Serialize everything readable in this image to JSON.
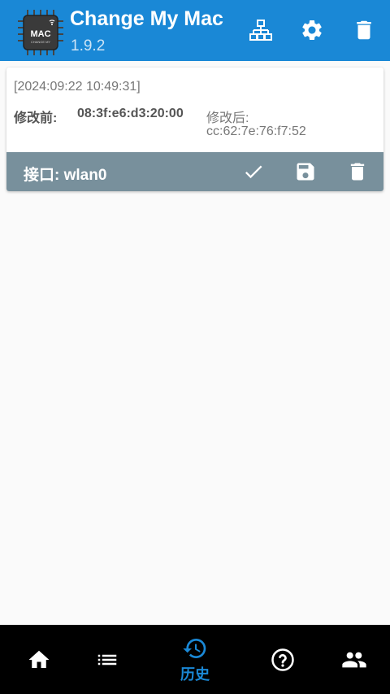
{
  "app": {
    "title": "Change My Mac",
    "version": "1.9.2",
    "logo_text": "MAC",
    "logo_subtext": "CHANGE MY"
  },
  "toolbar": {
    "icons": [
      "network-icon",
      "settings-icon",
      "delete-icon"
    ]
  },
  "history": {
    "entries": [
      {
        "timestamp": "[2024:09:22 10:49:31]",
        "before_label": "修改前:",
        "before_value": "08:3f:e6:d3:20:00",
        "after_label": "修改后:",
        "after_value": "cc:62:7e:76:f7:52",
        "interface_label": "接口: wlan0",
        "actions": [
          "check-icon",
          "save-icon",
          "delete-icon"
        ]
      }
    ]
  },
  "bottom_nav": {
    "items": [
      {
        "icon": "home-icon",
        "label": ""
      },
      {
        "icon": "list-icon",
        "label": ""
      },
      {
        "icon": "history-icon",
        "label": "历史",
        "active": true
      },
      {
        "icon": "help-icon",
        "label": ""
      },
      {
        "icon": "people-icon",
        "label": ""
      }
    ]
  },
  "colors": {
    "appbar": "#1a88d6",
    "card_footer": "#78909c",
    "nav_active": "#1a88d6",
    "nav_background": "#000000",
    "background": "#fafafa"
  }
}
